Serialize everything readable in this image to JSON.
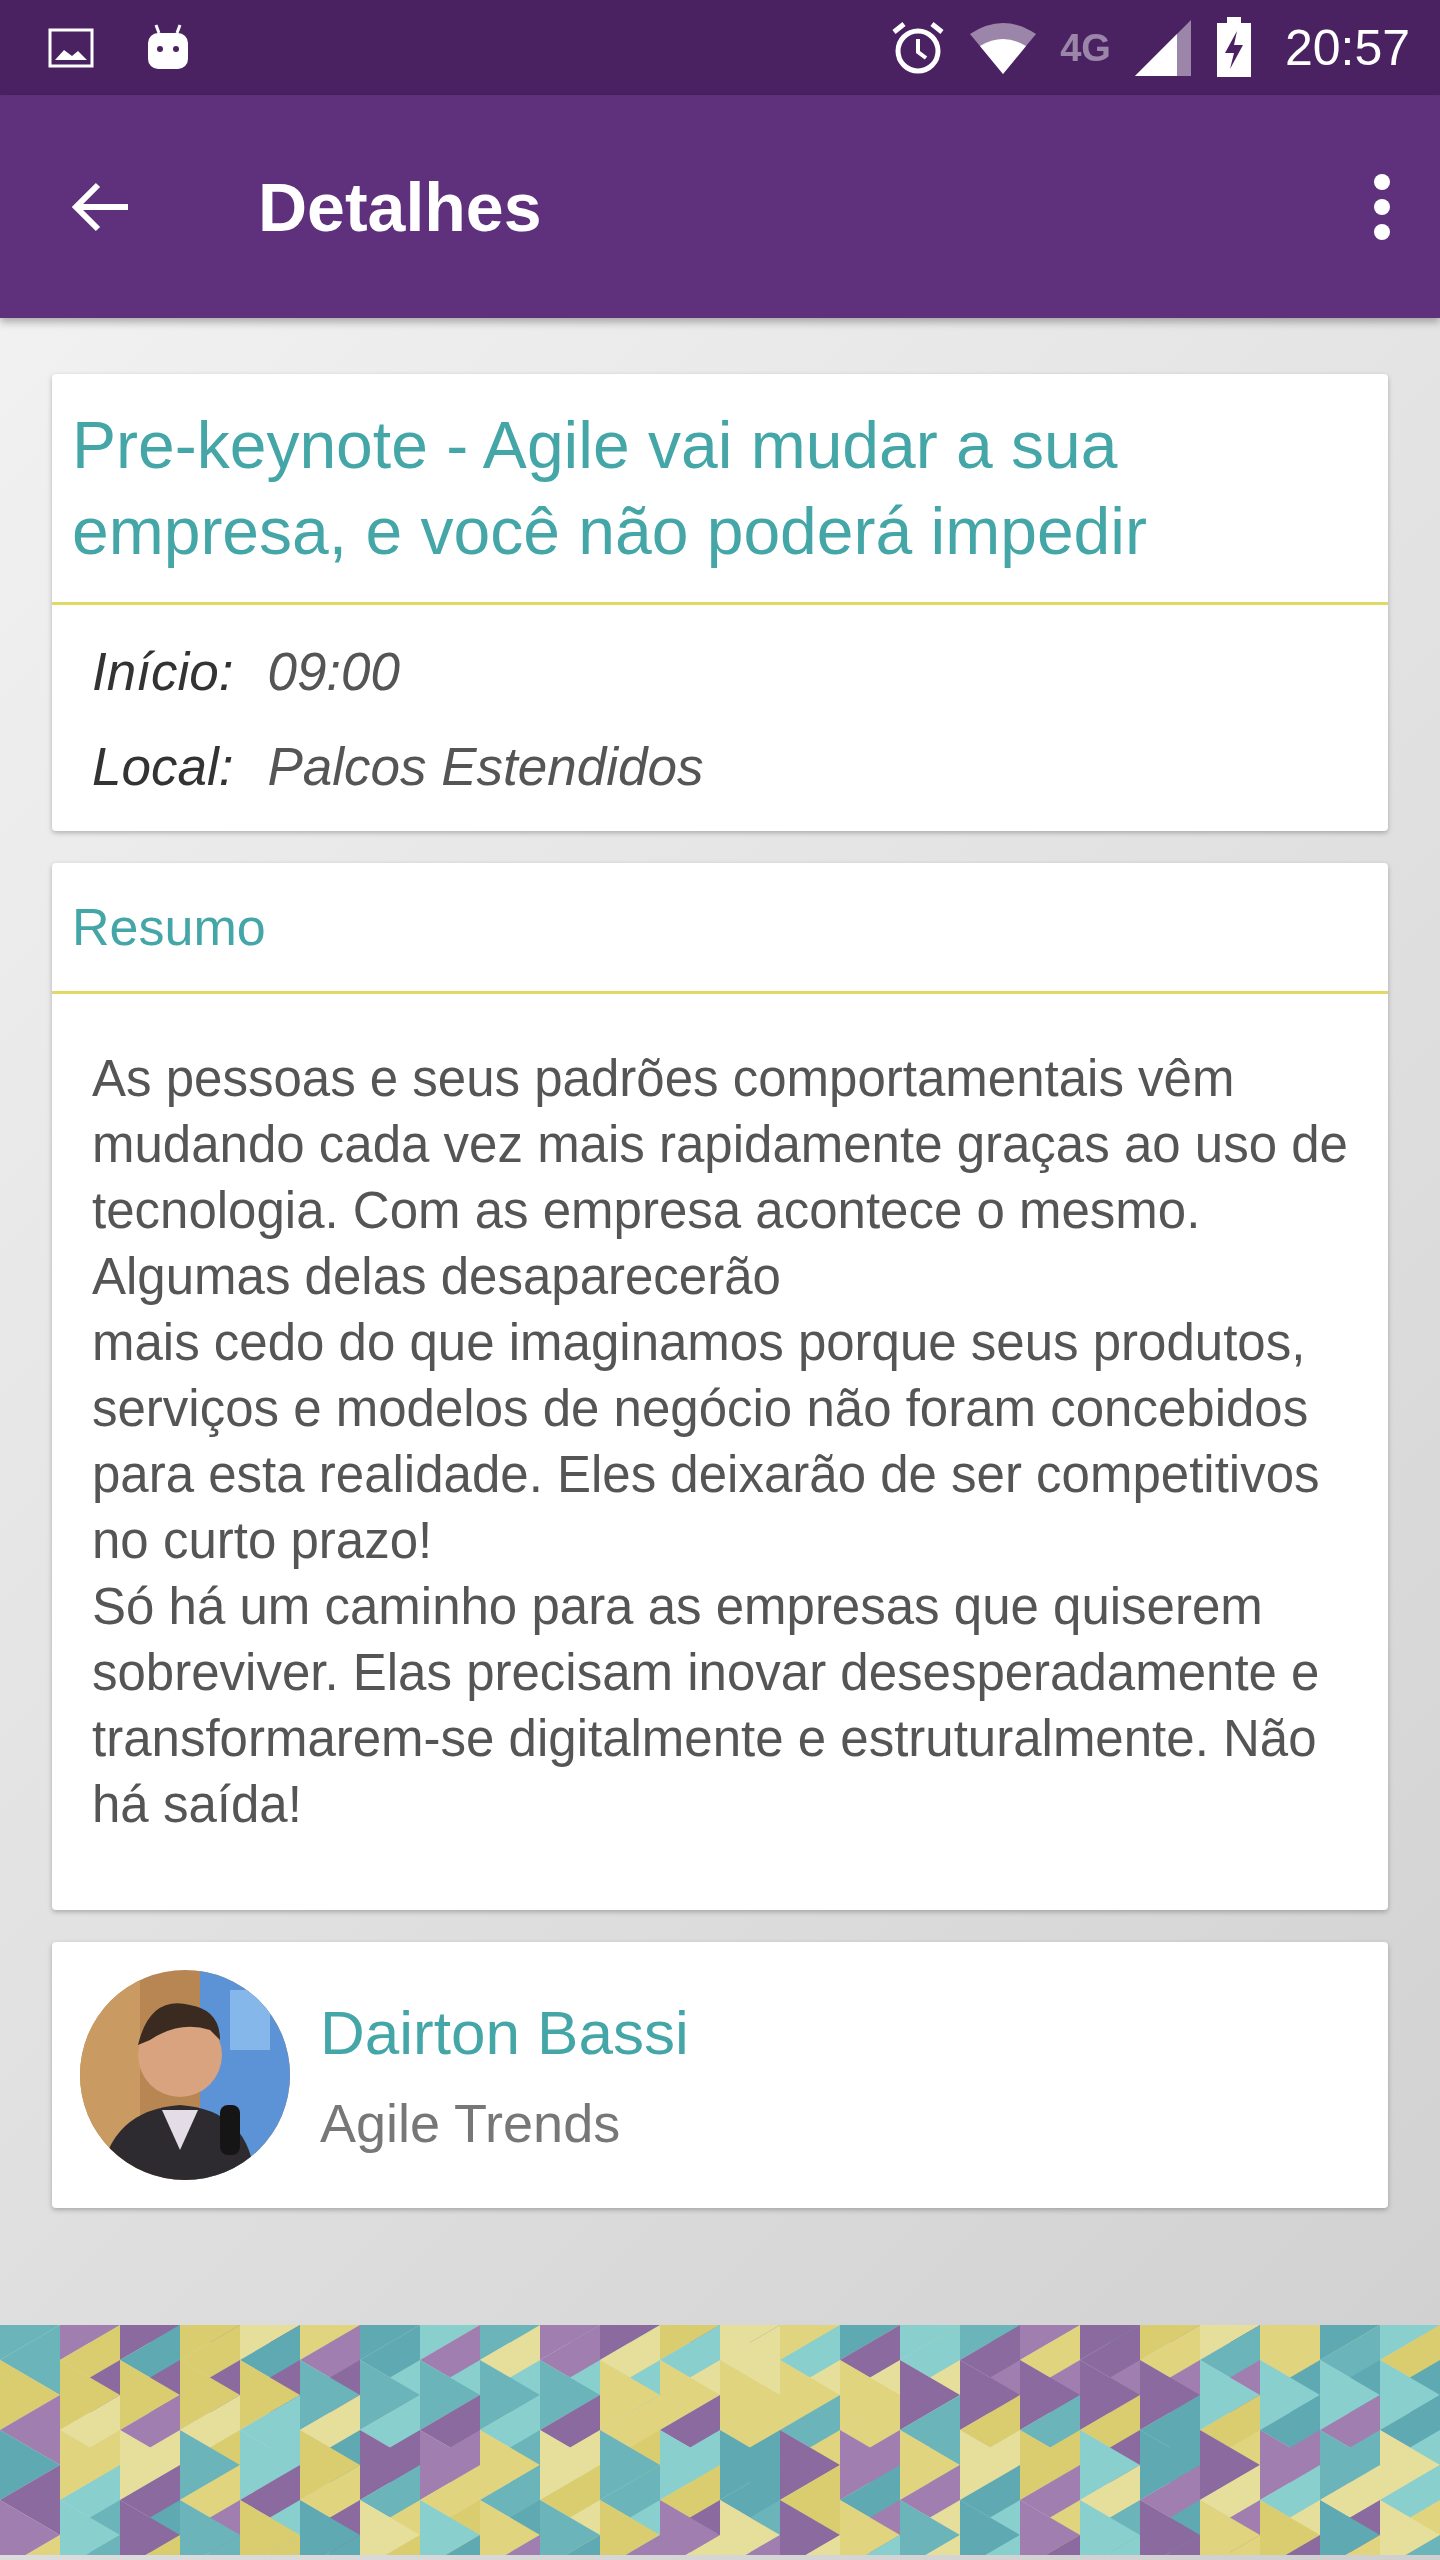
{
  "status_bar": {
    "network": "4G",
    "time": "20:57"
  },
  "app_bar": {
    "title": "Detalhes"
  },
  "session": {
    "title": "Pre-keynote - Agile vai mudar a sua empresa, e você não poderá impedir",
    "fields": [
      {
        "label": "Início:",
        "value": "09:00"
      },
      {
        "label": "Local:",
        "value": "Palcos Estendidos"
      }
    ]
  },
  "summary": {
    "heading": "Resumo",
    "text": "As pessoas e seus padrões comportamentais vêm mudando cada vez mais rapidamente graças ao uso de tecnologia. Com as empresa acontece o mesmo. Algumas delas desaparecerão\nmais cedo do que imaginamos porque seus produtos, serviços e modelos de negócio não foram concebidos para esta realidade. Eles deixarão de ser competitivos no curto prazo!\nSó há um caminho para as empresas que quiserem sobreviver. Elas precisam inovar desesperadamente e transformarem-se digitalmente e estruturalmente. Não há saída!"
  },
  "speaker": {
    "name": "Dairton Bassi",
    "company": "Agile Trends"
  }
}
